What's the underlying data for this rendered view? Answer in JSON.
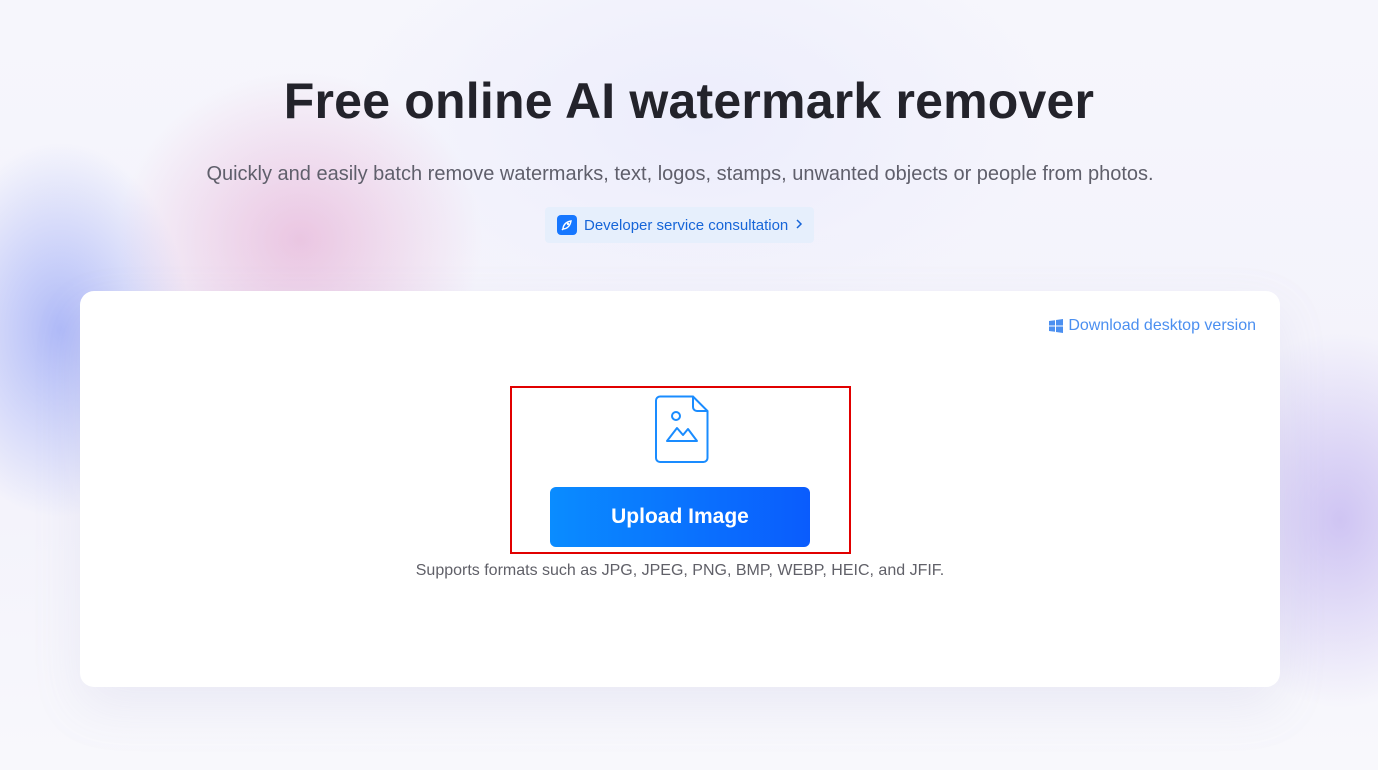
{
  "header": {
    "title": "Free online AI watermark remover",
    "subtitle": "Quickly and easily batch remove watermarks, text, logos, stamps, unwanted objects or people from photos.",
    "dev_link": {
      "label": "Developer service consultation",
      "icon": "rocket-icon",
      "chevron": "chevron-right-icon"
    }
  },
  "upload_card": {
    "download_link": {
      "label": "Download desktop version",
      "icon": "windows-icon"
    },
    "file_icon": "image-file-icon",
    "upload_button_label": "Upload Image",
    "formats_text": "Supports formats such as JPG, JPEG, PNG, BMP, WEBP, HEIC, and JFIF."
  },
  "colors": {
    "primary_blue": "#0a6cff",
    "link_blue": "#4b8ff0",
    "highlight_red": "#e10000",
    "title_text": "#23232b"
  }
}
